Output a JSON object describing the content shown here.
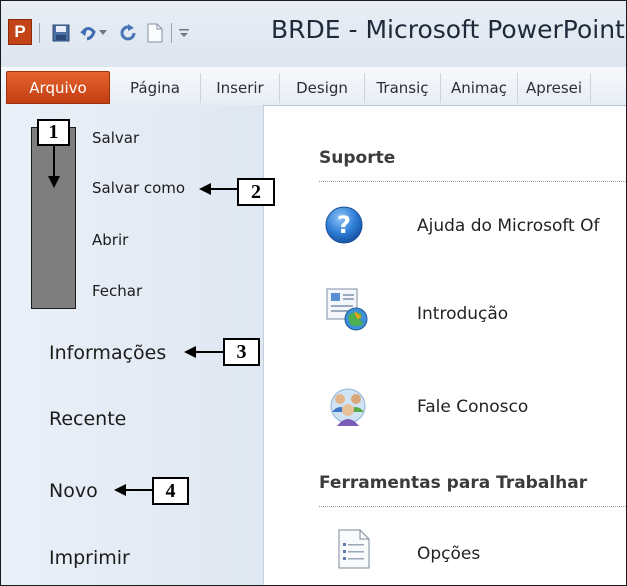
{
  "window": {
    "title": "BRDE - Microsoft PowerPoint",
    "app_icon_letter": "P"
  },
  "tabs": [
    "Arquivo",
    "Página",
    "Inserir",
    "Design",
    "Transiç",
    "Animaç",
    "Apresei"
  ],
  "backstage": {
    "commands": [
      "Salvar",
      "Salvar como",
      "Abrir",
      "Fechar"
    ],
    "nav": [
      "Informações",
      "Recente",
      "Novo",
      "Imprimir"
    ]
  },
  "callouts": [
    "1",
    "2",
    "3",
    "4"
  ],
  "help": {
    "support_heading": "Suporte",
    "support_items": [
      {
        "label": "Ajuda do Microsoft Of",
        "icon": "help-icon"
      },
      {
        "label": "Introdução",
        "icon": "getting-started-icon"
      },
      {
        "label": "Fale Conosco",
        "icon": "contact-us-icon"
      }
    ],
    "tools_heading": "Ferramentas para Trabalhar",
    "tools_items": [
      {
        "label": "Opções",
        "icon": "options-icon"
      }
    ]
  },
  "colors": {
    "file_tab": "#d5521f",
    "backstage_panel": "#e4ebf5",
    "callout_bar": "#7e7e7e"
  }
}
